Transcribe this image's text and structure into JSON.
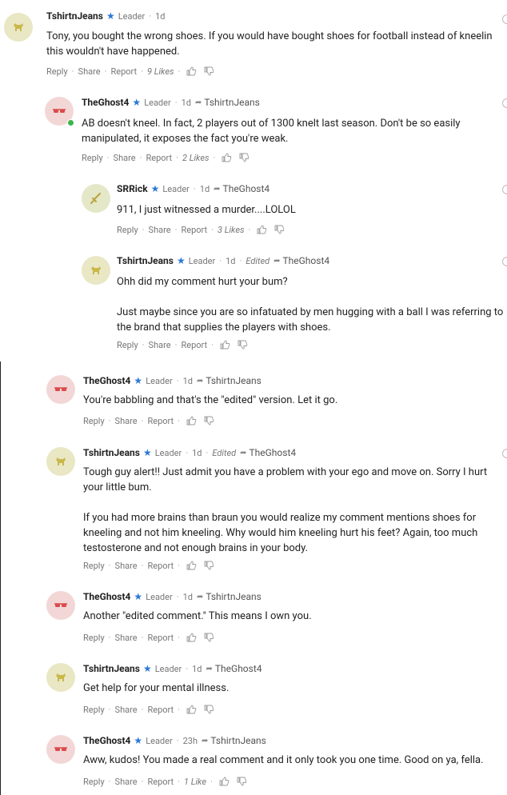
{
  "leader_label": "Leader",
  "actions": {
    "reply": "Reply",
    "share": "Share",
    "report": "Report"
  },
  "comments": [
    {
      "user": "TshirtnJeans",
      "time": "1d",
      "edited": "",
      "reply_to": "",
      "avatar": "dog",
      "paragraphs": [
        "Tony, you bought the wrong shoes. If you would have bought shoes for football instead of kneelin this wouldn't have happened."
      ],
      "likes": "9 Likes"
    },
    {
      "user": "TheGhost4",
      "time": "1d",
      "edited": "",
      "reply_to": "TshirtnJeans",
      "avatar": "glasses",
      "paragraphs": [
        "AB doesn't kneel.  In fact, 2 players out of 1300 knelt last season.  Don't be so easily manipulated, it exposes the fact you're weak."
      ],
      "likes": "2 Likes"
    },
    {
      "user": "SRRick",
      "time": "1d",
      "edited": "",
      "reply_to": "TheGhost4",
      "avatar": "sword",
      "paragraphs": [
        "911, I just witnessed a murder....LOLOL"
      ],
      "likes": "3 Likes"
    },
    {
      "user": "TshirtnJeans",
      "time": "1d",
      "edited": "Edited",
      "reply_to": "TheGhost4",
      "avatar": "dog",
      "paragraphs": [
        "Ohh did my comment hurt your bum?",
        "Just maybe since you are so infatuated by men hugging with a ball I was referring to the brand that supplies the players with shoes."
      ],
      "likes": ""
    },
    {
      "user": "TheGhost4",
      "time": "1d",
      "edited": "",
      "reply_to": "TshirtnJeans",
      "avatar": "glasses",
      "paragraphs": [
        "You're babbling and that's the \"edited\" version.  Let it go."
      ],
      "likes": ""
    },
    {
      "user": "TshirtnJeans",
      "time": "1d",
      "edited": "Edited",
      "reply_to": "TheGhost4",
      "avatar": "dog",
      "paragraphs": [
        "Tough guy alert!! Just admit you have a problem with your ego and move on. Sorry I hurt your little bum.",
        "If you had more brains than braun you would realize my comment mentions shoes for kneeling and not him kneeling. Why would him kneeling hurt his feet? Again, too much testosterone and not enough brains in your body."
      ],
      "likes": ""
    },
    {
      "user": "TheGhost4",
      "time": "1d",
      "edited": "",
      "reply_to": "TshirtnJeans",
      "avatar": "glasses",
      "paragraphs": [
        "Another \"edited comment.\"  This means I own you."
      ],
      "likes": ""
    },
    {
      "user": "TshirtnJeans",
      "time": "1d",
      "edited": "",
      "reply_to": "TheGhost4",
      "avatar": "dog",
      "paragraphs": [
        "Get help for your mental illness."
      ],
      "likes": ""
    },
    {
      "user": "TheGhost4",
      "time": "23h",
      "edited": "",
      "reply_to": "TshirtnJeans",
      "avatar": "glasses",
      "paragraphs": [
        "Aww, kudos!  You made a real comment and it only took you one time.  Good on ya, fella."
      ],
      "likes": "1 Like"
    }
  ]
}
